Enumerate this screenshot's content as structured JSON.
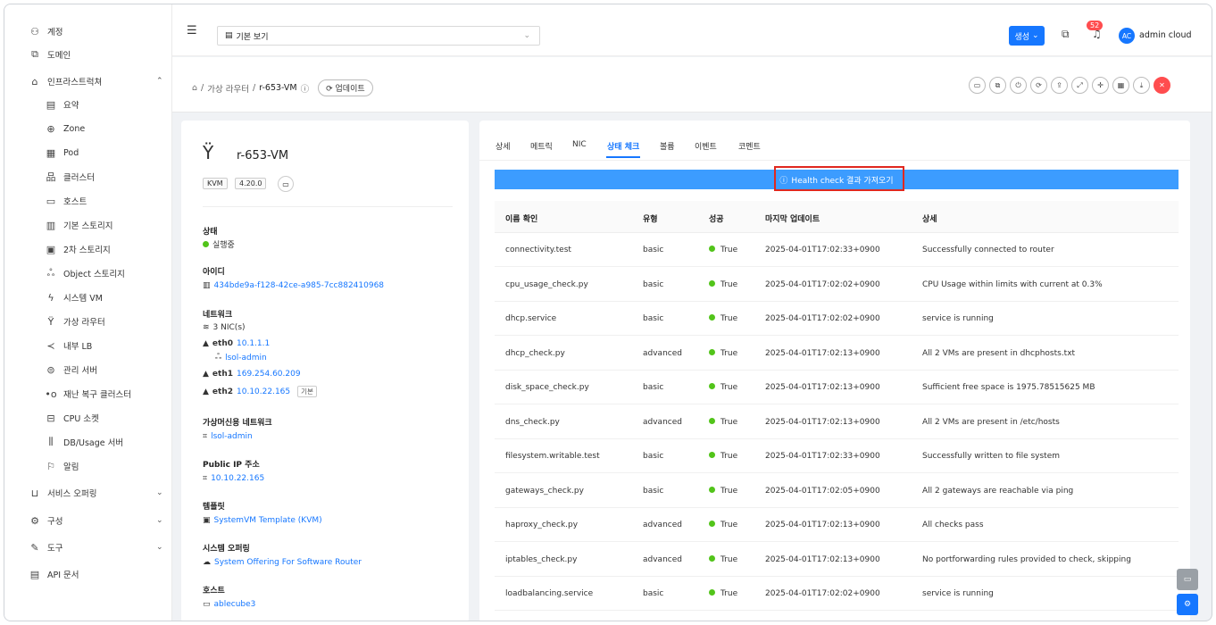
{
  "sidebar": {
    "items": [
      {
        "icon": "user-icon",
        "glyph": "⚇",
        "label": "계정",
        "sub": false,
        "chev": ""
      },
      {
        "icon": "domain-icon",
        "glyph": "⧉",
        "label": "도메인",
        "sub": false,
        "chev": ""
      },
      {
        "icon": "bank-icon",
        "glyph": "⌂",
        "label": "인프라스트럭쳐",
        "sub": false,
        "chev": "⌃"
      },
      {
        "icon": "summary-icon",
        "glyph": "▤",
        "label": "요약",
        "sub": true,
        "chev": ""
      },
      {
        "icon": "globe-icon",
        "glyph": "⊕",
        "label": "Zone",
        "sub": true,
        "chev": ""
      },
      {
        "icon": "pod-icon",
        "glyph": "▦",
        "label": "Pod",
        "sub": true,
        "chev": ""
      },
      {
        "icon": "cluster-icon",
        "glyph": "品",
        "label": "클러스터",
        "sub": true,
        "chev": ""
      },
      {
        "icon": "host-icon",
        "glyph": "▭",
        "label": "호스트",
        "sub": true,
        "chev": ""
      },
      {
        "icon": "primary-storage-icon",
        "glyph": "▥",
        "label": "기본 스토리지",
        "sub": true,
        "chev": ""
      },
      {
        "icon": "secondary-storage-icon",
        "glyph": "▣",
        "label": "2차 스토리지",
        "sub": true,
        "chev": ""
      },
      {
        "icon": "object-storage-icon",
        "glyph": "ஃ",
        "label": "Object 스토리지",
        "sub": true,
        "chev": ""
      },
      {
        "icon": "system-vm-icon",
        "glyph": "ϟ",
        "label": "시스템 VM",
        "sub": true,
        "chev": ""
      },
      {
        "icon": "router-icon",
        "glyph": "Ÿ",
        "label": "가상 라우터",
        "sub": true,
        "chev": ""
      },
      {
        "icon": "share-icon",
        "glyph": "≺",
        "label": "내부 LB",
        "sub": true,
        "chev": ""
      },
      {
        "icon": "management-icon",
        "glyph": "⊜",
        "label": "관리 서버",
        "sub": true,
        "chev": ""
      },
      {
        "icon": "dr-cluster-icon",
        "glyph": "•o",
        "label": "재난 복구 클러스터",
        "sub": true,
        "chev": ""
      },
      {
        "icon": "cpu-socket-icon",
        "glyph": "⊟",
        "label": "CPU 소켓",
        "sub": true,
        "chev": ""
      },
      {
        "icon": "db-usage-icon",
        "glyph": "⫼",
        "label": "DB/Usage 서버",
        "sub": true,
        "chev": ""
      },
      {
        "icon": "alert-icon",
        "glyph": "⚐",
        "label": "알림",
        "sub": true,
        "chev": ""
      },
      {
        "icon": "shopping-icon",
        "glyph": "⊔",
        "label": "서비스 오퍼링",
        "sub": false,
        "chev": "⌄"
      },
      {
        "icon": "settings-icon",
        "glyph": "⚙",
        "label": "구성",
        "sub": false,
        "chev": "⌄"
      },
      {
        "icon": "tool-icon",
        "glyph": "✎",
        "label": "도구",
        "sub": false,
        "chev": "⌄"
      },
      {
        "icon": "api-doc-icon",
        "glyph": "▤",
        "label": "API 문서",
        "sub": false,
        "chev": ""
      }
    ]
  },
  "topbar": {
    "view_label": "기본 보기",
    "create_label": "생성",
    "notif_count": "52",
    "avatar": "AC",
    "username": "admin cloud"
  },
  "breadcrumb": {
    "level1": "가상 라우터",
    "current": "r-653-VM",
    "update_label": "업데이트"
  },
  "vm": {
    "name": "r-653-VM",
    "hypervisor": "KVM",
    "version": "4.20.0",
    "status_label": "상태",
    "status": "실행중",
    "id_label": "아이디",
    "id": "434bde9a-f128-42ce-a985-7cc882410968",
    "network_label": "네트워크",
    "nic_count": "3 NIC(s)",
    "eth0_name": "eth0",
    "eth0_ip": "10.1.1.1",
    "eth0_net": "lsol-admin",
    "eth1_name": "eth1",
    "eth1_ip": "169.254.60.209",
    "eth2_name": "eth2",
    "eth2_ip": "10.10.22.165",
    "eth2_tag": "기본",
    "guest_net_label": "가상머신용 네트워크",
    "guest_net": "lsol-admin",
    "public_ip_label": "Public IP 주소",
    "public_ip": "10.10.22.165",
    "template_label": "템플릿",
    "template": "SystemVM Template (KVM)",
    "offering_label": "시스템 오퍼링",
    "offering": "System Offering For Software Router",
    "host_label": "호스트",
    "host": "ablecube3"
  },
  "tabs": [
    "상세",
    "메트릭",
    "NIC",
    "상태 체크",
    "볼륨",
    "이벤트",
    "코멘트"
  ],
  "health_button": "Health check 결과 가져오기",
  "table": {
    "headers": [
      "이름 확인",
      "유형",
      "성공",
      "마지막 업데이트",
      "상세"
    ],
    "rows": [
      [
        "connectivity.test",
        "basic",
        "True",
        "2025-04-01T17:02:33+0900",
        "Successfully connected to router"
      ],
      [
        "cpu_usage_check.py",
        "basic",
        "True",
        "2025-04-01T17:02:02+0900",
        "CPU Usage within limits with current at 0.3%"
      ],
      [
        "dhcp.service",
        "basic",
        "True",
        "2025-04-01T17:02:02+0900",
        "service is running"
      ],
      [
        "dhcp_check.py",
        "advanced",
        "True",
        "2025-04-01T17:02:13+0900",
        "All 2 VMs are present in dhcphosts.txt"
      ],
      [
        "disk_space_check.py",
        "basic",
        "True",
        "2025-04-01T17:02:13+0900",
        "Sufficient free space is 1975.78515625 MB"
      ],
      [
        "dns_check.py",
        "advanced",
        "True",
        "2025-04-01T17:02:13+0900",
        "All 2 VMs are present in /etc/hosts"
      ],
      [
        "filesystem.writable.test",
        "basic",
        "True",
        "2025-04-01T17:02:33+0900",
        "Successfully written to file system"
      ],
      [
        "gateways_check.py",
        "basic",
        "True",
        "2025-04-01T17:02:05+0900",
        "All 2 gateways are reachable via ping"
      ],
      [
        "haproxy_check.py",
        "advanced",
        "True",
        "2025-04-01T17:02:13+0900",
        "All checks pass"
      ],
      [
        "iptables_check.py",
        "advanced",
        "True",
        "2025-04-01T17:02:13+0900",
        "No portforwarding rules provided to check, skipping"
      ],
      [
        "loadbalancing.service",
        "basic",
        "True",
        "2025-04-01T17:02:02+0900",
        "service is running"
      ]
    ]
  }
}
